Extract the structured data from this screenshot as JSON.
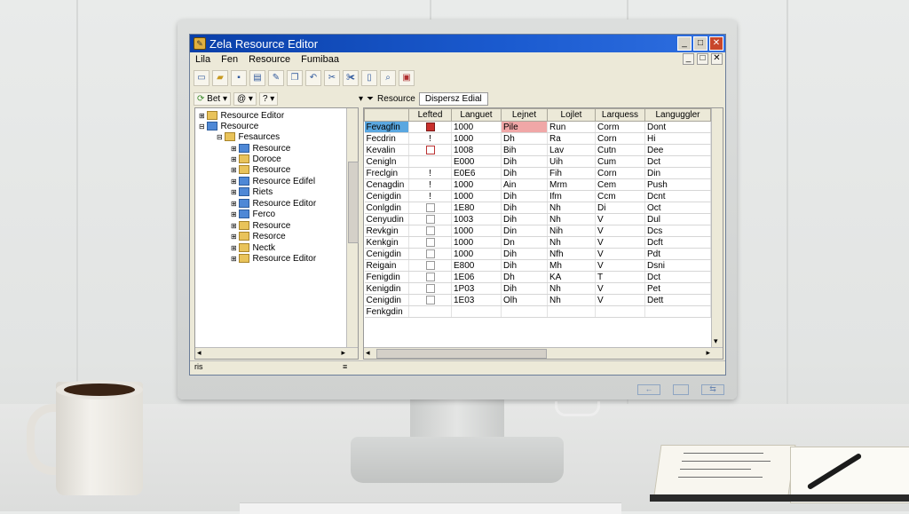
{
  "window": {
    "title": "Zela Resource Editor",
    "min_label": "_",
    "max_label": "□",
    "close_label": "✕"
  },
  "menubar": [
    "Lila",
    "Fen",
    "Resource",
    "Fumibaa"
  ],
  "mdi_controls": [
    "_",
    "□",
    "✕"
  ],
  "toolbar_icons": [
    "new-icon",
    "open-icon",
    "save-icon",
    "print-icon",
    "edit-icon",
    "copy-icon",
    "undo-icon",
    "cut-icon",
    "scissors-icon",
    "document-icon",
    "search-icon",
    "properties-icon"
  ],
  "toolbar2": {
    "item1": "Bet",
    "item2": "@",
    "item3": "?"
  },
  "breadcrumb": {
    "label": "Resource",
    "tab": "Dispersz Edial"
  },
  "tree": [
    {
      "label": "Resource Editor",
      "indent": 1,
      "icon": "yellow"
    },
    {
      "label": "Resource",
      "indent": 1,
      "icon": "blue"
    },
    {
      "label": "Fesaurces",
      "indent": 2,
      "icon": "yellow"
    },
    {
      "label": "Resource",
      "indent": 3,
      "icon": "blue"
    },
    {
      "label": "Doroce",
      "indent": 3,
      "icon": "yellow"
    },
    {
      "label": "Resource",
      "indent": 3,
      "icon": "yellow"
    },
    {
      "label": "Resource Edifel",
      "indent": 3,
      "icon": "blue"
    },
    {
      "label": "Riets",
      "indent": 3,
      "icon": "blue"
    },
    {
      "label": "Resource Editor",
      "indent": 3,
      "icon": "blue"
    },
    {
      "label": "Ferco",
      "indent": 3,
      "icon": "blue"
    },
    {
      "label": "Resource",
      "indent": 3,
      "icon": "yellow"
    },
    {
      "label": "Resorce",
      "indent": 3,
      "icon": "yellow"
    },
    {
      "label": "Nectk",
      "indent": 3,
      "icon": "yellow"
    },
    {
      "label": "Resource Editor",
      "indent": 3,
      "icon": "yellow"
    }
  ],
  "grid": {
    "headers": [
      "",
      "Lefted",
      "Languet",
      "Lejnet",
      "Lojlet",
      "Larquess",
      "Languggler"
    ],
    "rows": [
      [
        "Fevagfin",
        "red-check",
        "1000",
        "Pile",
        "Run",
        "Corm",
        "Dont"
      ],
      [
        "Fecdrin",
        "!",
        "1000",
        "Dh",
        "Ra",
        "Corn",
        "Hi"
      ],
      [
        "Kevalin",
        "box-red",
        "1008",
        "Bih",
        "Lav",
        "Cutn",
        "Dee"
      ],
      [
        "Cenigln",
        "",
        "E000",
        "Dih",
        "Uih",
        "Cum",
        "Dct"
      ],
      [
        "Freclgin",
        "!",
        "E0E6",
        "Dih",
        "Fih",
        "Corn",
        "Din"
      ],
      [
        "Cenagdin",
        "!",
        "1000",
        "Ain",
        "Mrm",
        "Cem",
        "Push"
      ],
      [
        "Cenigdin",
        "!",
        "1000",
        "Dih",
        "Ifm",
        "Ccm",
        "Dcnt"
      ],
      [
        "Conlgdin",
        "box",
        "1E80",
        "Dih",
        "Nh",
        "Di",
        "Oct"
      ],
      [
        "Cenyudin",
        "box",
        "1003",
        "Dih",
        "Nh",
        "V",
        "Dul"
      ],
      [
        "Revkgin",
        "box",
        "1000",
        "Din",
        "Nih",
        "V",
        "Dcs"
      ],
      [
        "Kenkgin",
        "box",
        "1000",
        "Dn",
        "Nh",
        "V",
        "Dcft"
      ],
      [
        "Cenigdin",
        "box",
        "1000",
        "Dih",
        "Nfh",
        "V",
        "Pdt"
      ],
      [
        "Reigain",
        "box",
        "E800",
        "Dih",
        "Mh",
        "V",
        "Dsni"
      ],
      [
        "Fenigdin",
        "box",
        "1E06",
        "Dh",
        "KA",
        "T",
        "Dct"
      ],
      [
        "Kenigdin",
        "box",
        "1P03",
        "Dih",
        "Nh",
        "V",
        "Pet"
      ],
      [
        "Cenigdin",
        "box",
        "1E03",
        "Olh",
        "Nh",
        "V",
        "Dett"
      ],
      [
        "Fenkgdin",
        "",
        "",
        "",
        "",
        "",
        ""
      ]
    ]
  },
  "statusbar": {
    "left": "ris",
    "mid": "≡"
  },
  "monitor_buttons": [
    "←",
    "",
    "⇆"
  ]
}
